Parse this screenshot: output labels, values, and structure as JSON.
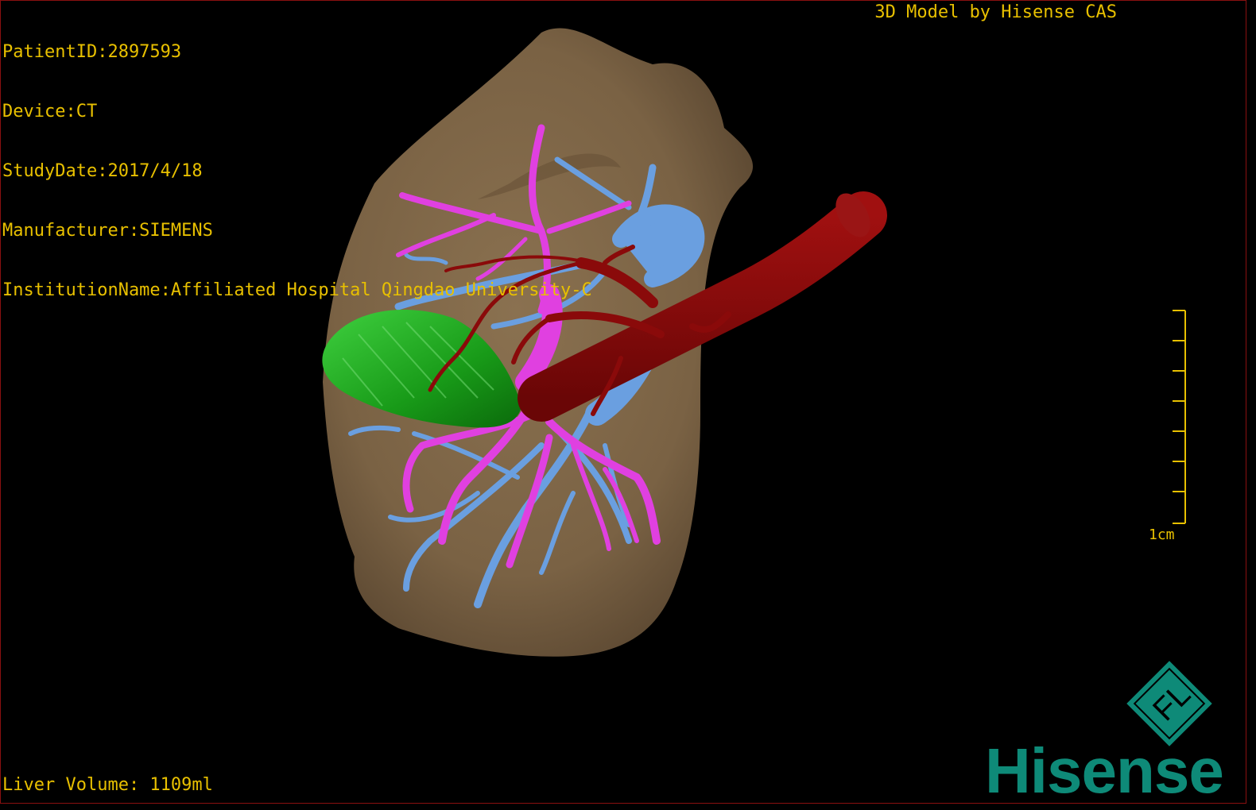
{
  "patient_info": {
    "patient_id": "PatientID:2897593",
    "device": "Device:CT",
    "study_date": "StudyDate:2017/4/18",
    "manufacturer": "Manufacturer:SIEMENS",
    "institution": "InstitutionName:Affiliated Hospital Qingdao University-C"
  },
  "credit": "3D Model by Hisense CAS",
  "liver_volume": "Liver Volume: 1109ml",
  "scale_bar": {
    "label": "1cm",
    "color": "#e8c000"
  },
  "logo": {
    "mark_text": "FL",
    "brand": "Hisense",
    "color": "#0e8a78"
  },
  "colors": {
    "liver": "#7d6546",
    "portal_vein": "#e040e0",
    "hepatic_vein": "#6a9fe0",
    "artery": "#8a0a0a",
    "tumor": "#1fa01f",
    "text": "#e8c000"
  }
}
